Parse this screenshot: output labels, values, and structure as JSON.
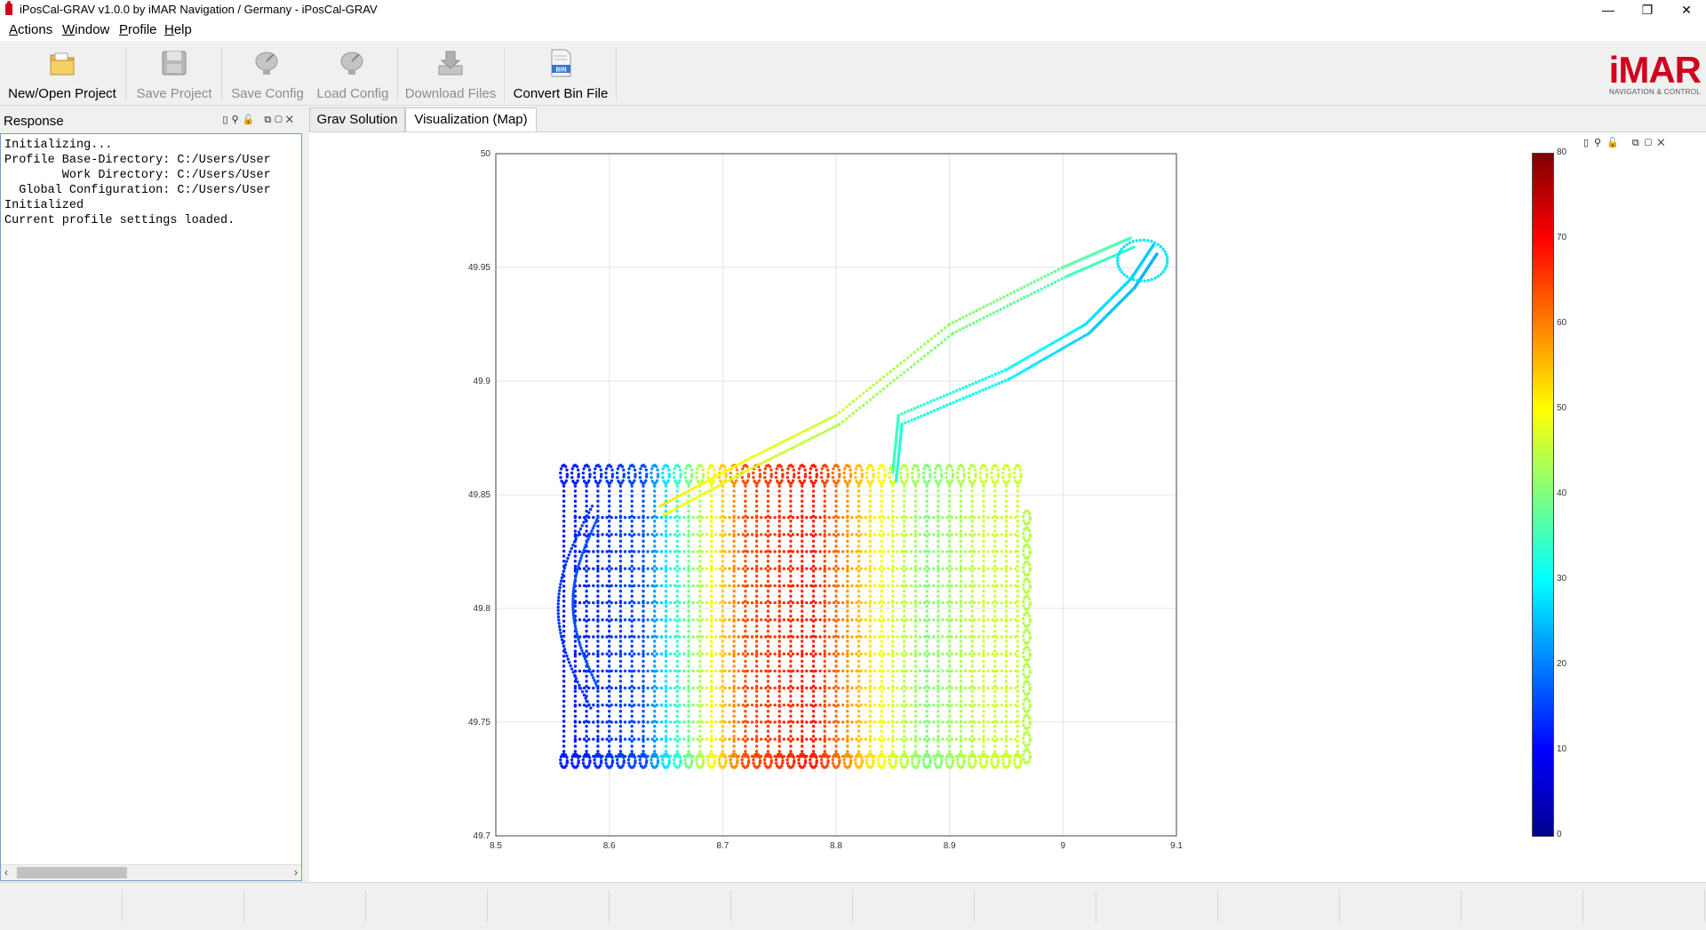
{
  "window": {
    "title": "iPosCal-GRAV v1.0.0 by iMAR Navigation / Germany - iPosCal-GRAV"
  },
  "menu": [
    "Actions",
    "Window",
    "Profile",
    "Help"
  ],
  "toolbar": {
    "buttons": [
      {
        "label": "New/Open Project",
        "icon": "folder-icon",
        "enabled": true
      },
      {
        "label": "Save Project",
        "icon": "floppy-disk-icon",
        "enabled": false
      },
      {
        "label": "Save Config",
        "icon": "satellite-dish-icon",
        "enabled": false
      },
      {
        "label": "Load Config",
        "icon": "satellite-dish-icon",
        "enabled": false
      },
      {
        "label": "Download Files",
        "icon": "download-icon",
        "enabled": false
      },
      {
        "label": "Convert Bin File",
        "icon": "bin-file-icon",
        "enabled": true
      }
    ]
  },
  "logo": {
    "text": "iMAR",
    "subtitle": "NAVIGATION & CONTROL"
  },
  "response_panel": {
    "title": "Response",
    "lines": [
      "Initializing...",
      "Profile Base-Directory: C:/Users/User",
      "        Work Directory: C:/Users/User",
      "  Global Configuration: C:/Users/User",
      "Initialized",
      "Current profile settings loaded."
    ]
  },
  "tabs": [
    {
      "label": "Grav Solution",
      "active": false
    },
    {
      "label": "Visualization (Map)",
      "active": true
    }
  ],
  "chart_data": {
    "type": "scatter",
    "title": "",
    "xlabel": "",
    "ylabel": "",
    "xlim": [
      8.5,
      9.1
    ],
    "ylim": [
      49.7,
      50.0
    ],
    "x_ticks": [
      "8.5",
      "8.6",
      "8.7",
      "8.8",
      "8.9",
      "9",
      "9.1"
    ],
    "y_ticks": [
      "49.7",
      "49.75",
      "49.8",
      "49.85",
      "49.9",
      "49.95",
      "50"
    ],
    "grid": true,
    "colormap": "jet",
    "colorbar": {
      "min": 0,
      "max": 80,
      "ticks": [
        "0",
        "10",
        "20",
        "30",
        "40",
        "50",
        "60",
        "70",
        "80"
      ]
    },
    "survey_grid": {
      "x_range": [
        8.56,
        8.96
      ],
      "y_range": [
        49.735,
        49.855
      ],
      "track_spacing_x": 0.01,
      "track_spacing_y": 0.0075
    },
    "value_by_x": [
      [
        8.57,
        12
      ],
      [
        8.63,
        16
      ],
      [
        8.66,
        34
      ],
      [
        8.72,
        64
      ],
      [
        8.78,
        68
      ],
      [
        8.83,
        52
      ],
      [
        8.88,
        40
      ],
      [
        8.93,
        46
      ]
    ],
    "transit_tracks": [
      {
        "value": 52,
        "points": [
          [
            8.645,
            49.845
          ],
          [
            8.72,
            49.865
          ],
          [
            8.8,
            49.885
          ],
          [
            8.9,
            49.925
          ],
          [
            9.0,
            49.95
          ],
          [
            9.06,
            49.963
          ]
        ]
      },
      {
        "value": 35,
        "points": [
          [
            8.85,
            49.86
          ],
          [
            8.855,
            49.885
          ],
          [
            8.95,
            49.905
          ],
          [
            9.02,
            49.925
          ],
          [
            9.06,
            49.945
          ],
          [
            9.08,
            49.96
          ]
        ]
      }
    ]
  },
  "status": {
    "segments": 14
  }
}
